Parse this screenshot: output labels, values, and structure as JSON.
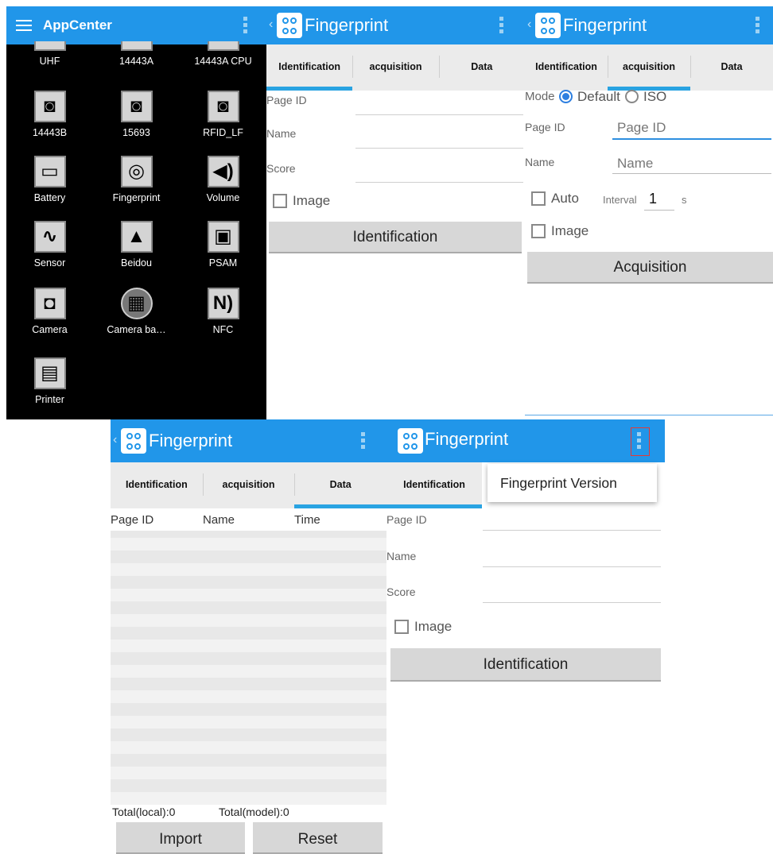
{
  "appcenter": {
    "title": "AppCenter",
    "apps": [
      {
        "label": "UHF",
        "icon": "uhf-icon",
        "glyph": ""
      },
      {
        "label": "14443A",
        "icon": "14443a-icon",
        "glyph": ""
      },
      {
        "label": "14443A CPU",
        "icon": "14443a-cpu-icon",
        "glyph": ""
      },
      {
        "label": "14443B",
        "icon": "card-reader-icon",
        "glyph": "◙"
      },
      {
        "label": "15693",
        "icon": "card-reader-icon",
        "glyph": "◙"
      },
      {
        "label": "RFID_LF",
        "icon": "card-reader-icon",
        "glyph": "◙"
      },
      {
        "label": "Battery",
        "icon": "battery-icon",
        "glyph": "▭"
      },
      {
        "label": "Fingerprint",
        "icon": "fingerprint-icon",
        "glyph": "◎"
      },
      {
        "label": "Volume",
        "icon": "volume-icon",
        "glyph": "◀)"
      },
      {
        "label": "Sensor",
        "icon": "sensor-icon",
        "glyph": "∿"
      },
      {
        "label": "Beidou",
        "icon": "navigation-icon",
        "glyph": "▲"
      },
      {
        "label": "PSAM",
        "icon": "sim-card-icon",
        "glyph": "▣"
      },
      {
        "label": "Camera",
        "icon": "camera-icon",
        "glyph": "◘"
      },
      {
        "label": "Camera ba…",
        "icon": "barcode-camera-icon",
        "glyph": "▦"
      },
      {
        "label": "NFC",
        "icon": "nfc-icon",
        "glyph": "N)"
      },
      {
        "label": "Printer",
        "icon": "printer-icon",
        "glyph": "▤"
      }
    ]
  },
  "app_title": "Fingerprint",
  "tabs": [
    "Identification",
    "acquisition",
    "Data"
  ],
  "identification": {
    "fields": [
      "Page ID",
      "Name",
      "Score"
    ],
    "image_label": "Image",
    "button": "Identification"
  },
  "acquisition": {
    "mode_label": "Mode",
    "mode_default": "Default",
    "mode_iso": "ISO",
    "page_id_label": "Page ID",
    "page_id_placeholder": "Page ID",
    "name_label": "Name",
    "name_placeholder": "Name",
    "auto_label": "Auto",
    "interval_label": "Interval",
    "interval_value": "1",
    "interval_unit": "s",
    "image_label": "Image",
    "button": "Acquisition"
  },
  "data": {
    "columns": [
      "Page ID",
      "Name",
      "Time"
    ],
    "total_local": "Total(local):0",
    "total_model": "Total(model):0",
    "import_button": "Import",
    "reset_button": "Reset"
  },
  "menu": {
    "item": "Fingerprint Version"
  }
}
